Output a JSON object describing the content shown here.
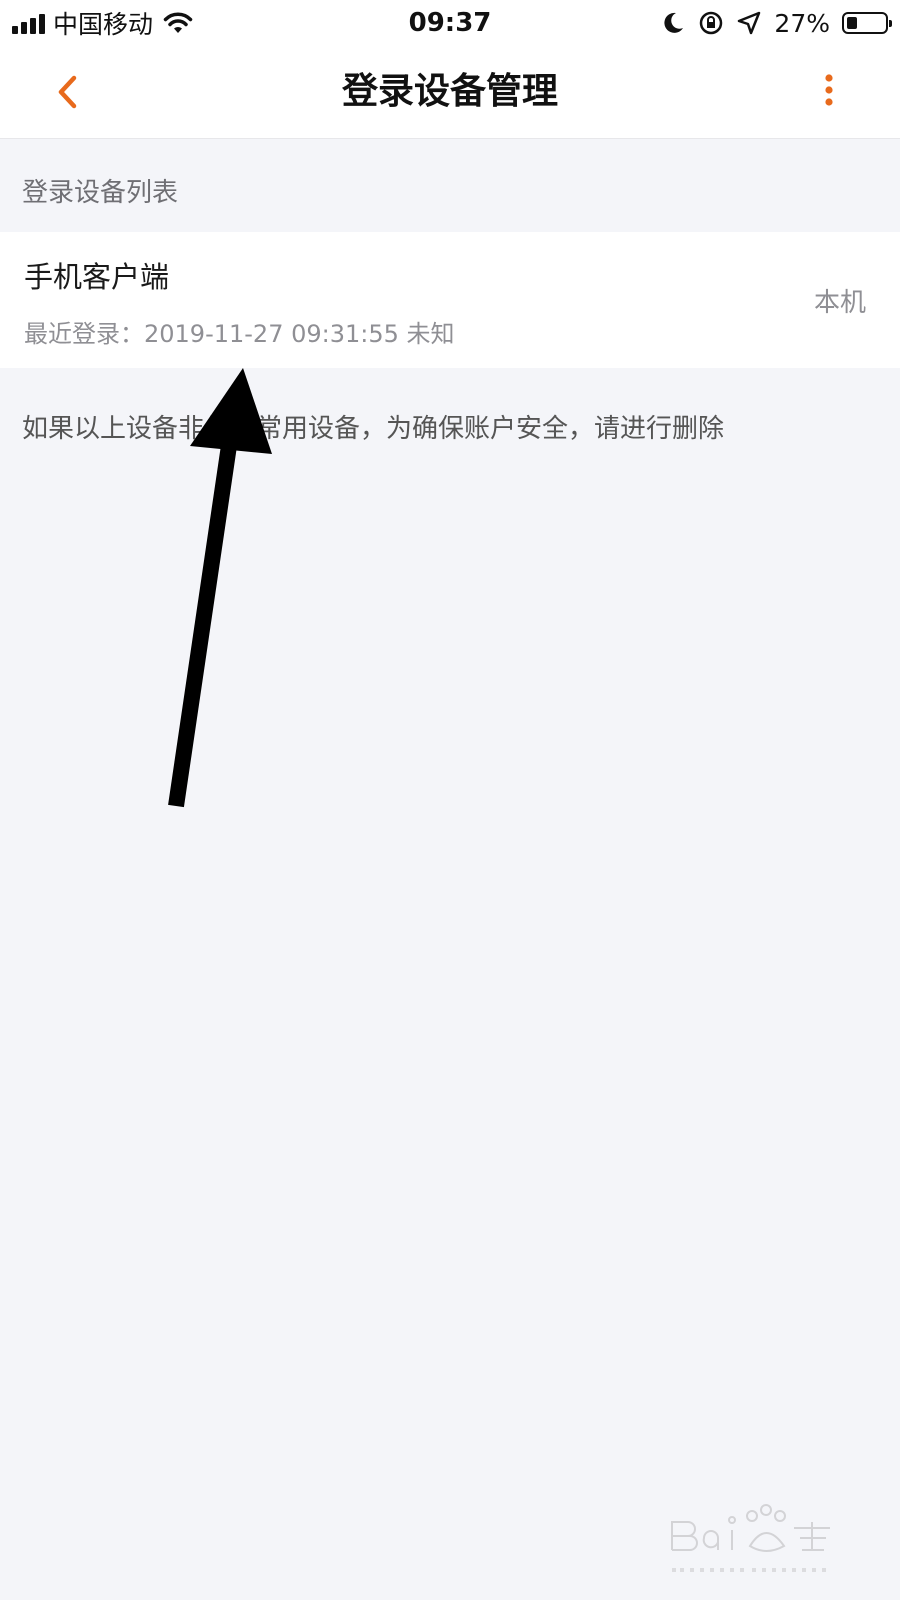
{
  "status_bar": {
    "carrier": "中国移动",
    "time": "09:37",
    "battery_percent": "27%",
    "battery_level": 0.27,
    "icons": [
      "signal-icon",
      "wifi-icon",
      "moon-icon",
      "orientation-lock-icon",
      "location-icon",
      "battery-icon"
    ]
  },
  "nav": {
    "title": "登录设备管理",
    "back_icon": "chevron-left-icon",
    "more_icon": "more-vertical-icon",
    "accent_color": "#e86a1c"
  },
  "section_header": "登录设备列表",
  "devices": [
    {
      "name": "手机客户端",
      "last_login": "最近登录：2019-11-27 09:31:55 未知",
      "tag": "本机"
    }
  ],
  "notice": "如果以上设备非你的常用设备，为确保账户安全，请进行删除",
  "annotation": {
    "icon": "arrow-annotation-icon",
    "color": "#000000"
  },
  "watermark": {
    "icon": "baidu-jingyan-watermark"
  }
}
